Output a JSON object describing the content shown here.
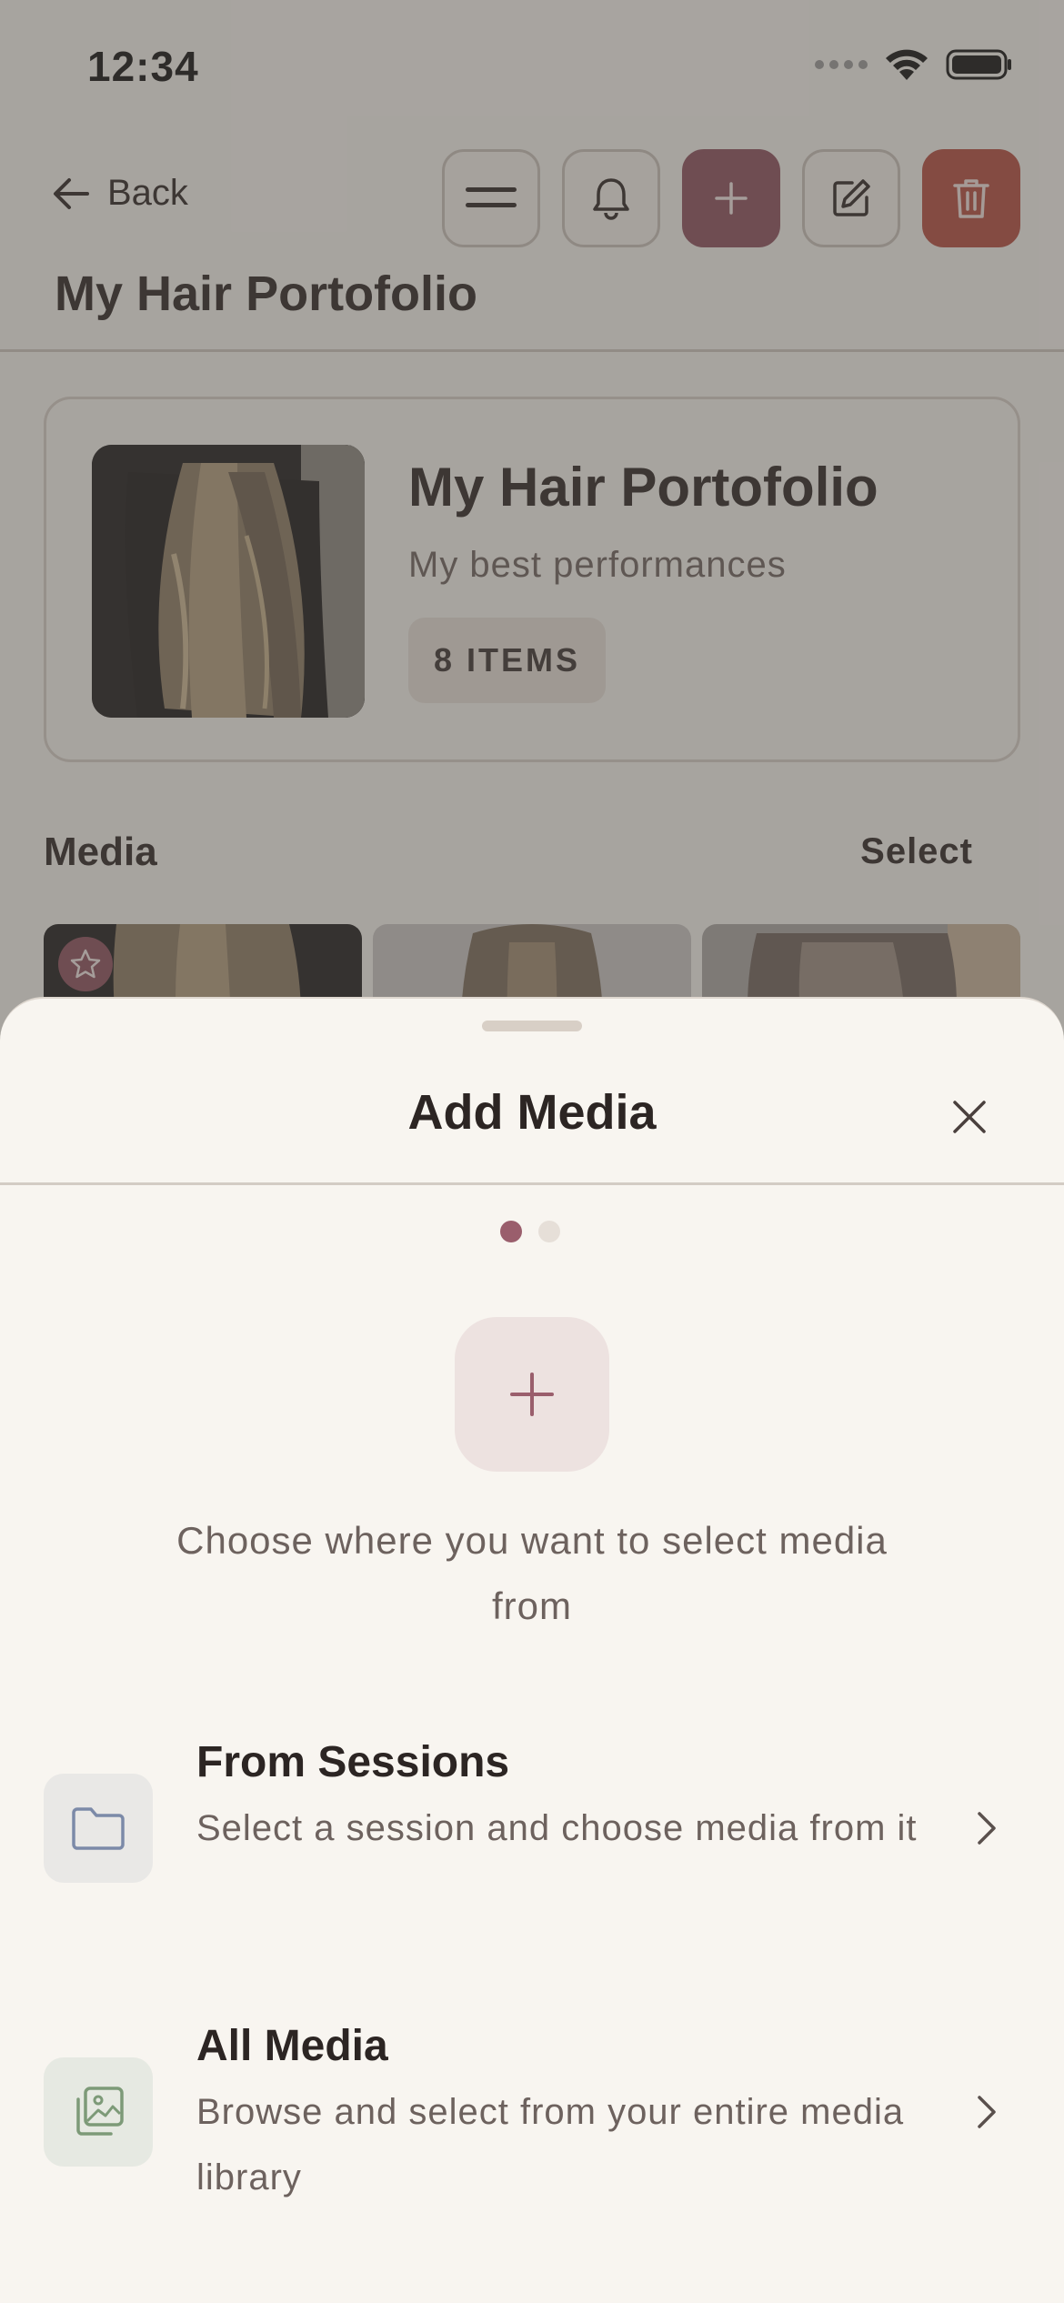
{
  "status_bar": {
    "time": "12:34"
  },
  "nav": {
    "back_label": "Back",
    "page_title": "My Hair Portofolio"
  },
  "toolbar": {
    "buttons": [
      {
        "icon": "menu-icon"
      },
      {
        "icon": "bell-icon"
      },
      {
        "icon": "plus-icon",
        "accent": "#8c4f5d"
      },
      {
        "icon": "edit-icon"
      },
      {
        "icon": "trash-icon",
        "accent": "#b54c3f"
      }
    ]
  },
  "portfolio": {
    "title": "My Hair Portofolio",
    "subtitle": "My best performances",
    "count_badge": "8 ITEMS"
  },
  "media_section": {
    "heading": "Media",
    "select_label": "Select"
  },
  "sheet": {
    "title": "Add Media",
    "prompt": "Choose where you want to select media from",
    "steps_total": 2,
    "step_current": 1,
    "options": [
      {
        "title": "From Sessions",
        "description": "Select a session and choose media from it",
        "icon": "folder-icon",
        "icon_color": "#7c8aa8",
        "icon_bg": "#e9e8e6"
      },
      {
        "title": "All Media",
        "description": "Browse and select from your entire media library",
        "icon": "gallery-icon",
        "icon_color": "#7d9a78",
        "icon_bg": "#e6e9e2"
      }
    ]
  },
  "colors": {
    "accent": "#8c4f5d",
    "danger": "#b54c3f",
    "background": "#f8f5f0"
  }
}
